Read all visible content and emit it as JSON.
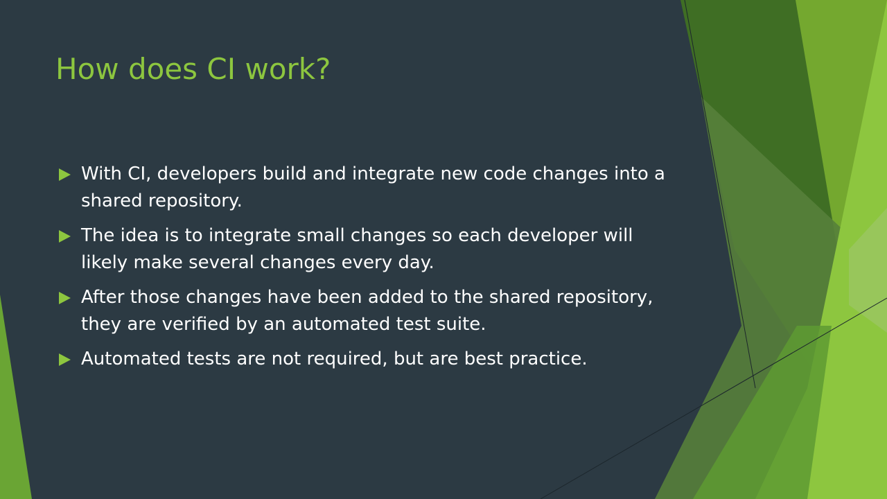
{
  "slide": {
    "title": "How does CI work?",
    "bullets": [
      "With CI, developers build and integrate new code changes into a shared repository.",
      "The idea is to integrate small changes so each developer will likely make several changes every day.",
      "After those changes have been added to the shared repository, they are verified by an automated test suite.",
      "Automated tests are not required, but are best practice."
    ]
  },
  "colors": {
    "background": "#2c3a43",
    "title": "#8dc63f",
    "body_text": "#ffffff",
    "bullet_icon": "#8dc63f",
    "accent_light_green": "#8dc63f",
    "accent_dark_green": "#3e6d23"
  },
  "icons": {
    "bullet": "triangle-bullet-icon"
  }
}
